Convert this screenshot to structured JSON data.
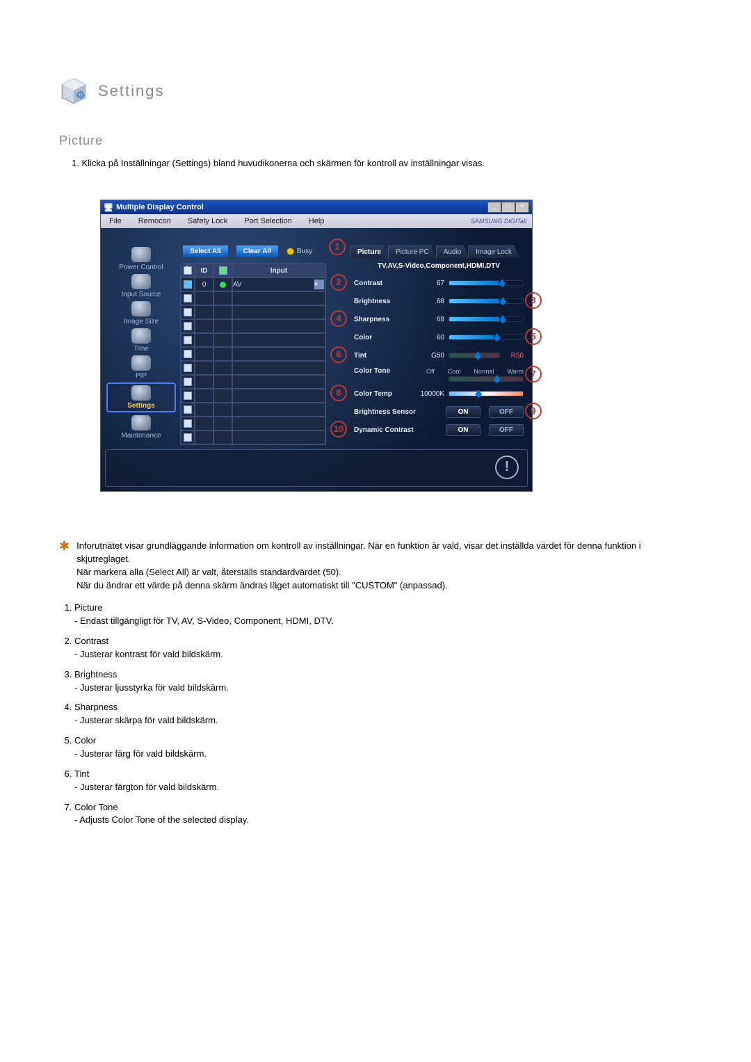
{
  "headings": {
    "settings": "Settings",
    "picture": "Picture"
  },
  "intro_num": "1.",
  "intro_text": "Klicka på Inställningar (Settings) bland huvudikonerna och skärmen för kontroll av inställningar visas.",
  "window": {
    "title": "Multiple Display Control",
    "min": "_",
    "max": "□",
    "close": "×",
    "menubar": [
      "File",
      "Remocon",
      "Safety Lock",
      "Port Selection",
      "Help"
    ],
    "brand": "SAMSUNG DIGITall"
  },
  "sidebar": {
    "items": [
      {
        "label": "Power Control"
      },
      {
        "label": "Input Source"
      },
      {
        "label": "Image Size"
      },
      {
        "label": "Time"
      },
      {
        "label": "PIP"
      },
      {
        "label": "Settings"
      },
      {
        "label": "Maintenance"
      }
    ]
  },
  "midpane": {
    "select_all": "Select All",
    "clear_all": "Clear All",
    "busy": "Busy",
    "headers": {
      "id": "ID",
      "input": "Input"
    },
    "row0": {
      "id": "0",
      "input": "AV"
    }
  },
  "rightpane": {
    "tabs": [
      "Picture",
      "Picture PC",
      "Audio",
      "Image Lock"
    ],
    "signals": "TV,AV,S-Video,Component,HDMI,DTV",
    "contrast": {
      "label": "Contrast",
      "value": "67"
    },
    "brightness": {
      "label": "Brightness",
      "value": "68"
    },
    "sharpness": {
      "label": "Sharpness",
      "value": "68"
    },
    "color": {
      "label": "Color",
      "value": "60"
    },
    "tint": {
      "label": "Tint",
      "g": "G50",
      "r": "R50"
    },
    "colortone": {
      "label": "Color Tone",
      "opts": [
        "Off",
        "Cool",
        "Normal",
        "Warm"
      ]
    },
    "colortemp": {
      "label": "Color Temp",
      "value": "10000K"
    },
    "brightsensor": {
      "label": "Brightness Sensor"
    },
    "dyncontrast": {
      "label": "Dynamic Contrast"
    },
    "on": "ON",
    "off": "OFF"
  },
  "callouts": [
    "1",
    "2",
    "3",
    "4",
    "5",
    "6",
    "7",
    "8",
    "9",
    "10"
  ],
  "starred": [
    "Inforutnätet visar grundläggande information om kontroll av inställningar. När en funktion är vald, visar det inställda värdet för denna funktion i skjutreglaget.",
    "När markera alla (Select All) är valt, återställs standardvärdet (50).",
    "När du ändrar ett värde på denna skärm ändras läget automatiskt till \"CUSTOM\" (anpassad)."
  ],
  "refs": [
    {
      "t": "Picture",
      "d": "- Endast tillgängligt för TV, AV, S-Video, Component, HDMI, DTV."
    },
    {
      "t": "Contrast",
      "d": "- Justerar kontrast för vald bildskärm."
    },
    {
      "t": "Brightness",
      "d": "- Justerar ljusstyrka för vald bildskärm."
    },
    {
      "t": "Sharpness",
      "d": "- Justerar skärpa för vald bildskärm."
    },
    {
      "t": "Color",
      "d": "- Justerar färg för vald bildskärm."
    },
    {
      "t": "Tint",
      "d": "- Justerar färgton för vald bildskärm."
    },
    {
      "t": "Color Tone",
      "d": "- Adjusts Color Tone of the selected display."
    }
  ]
}
